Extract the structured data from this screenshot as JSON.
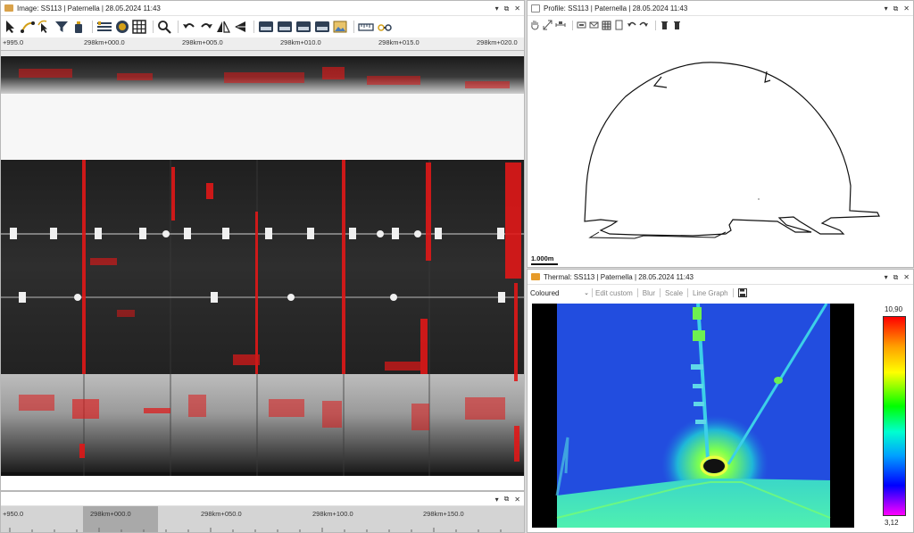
{
  "image_panel": {
    "title": "Image: SS113 | Paternella | 28.05.2024 11:43",
    "window_controls": [
      "▾",
      "⧉",
      "✕"
    ],
    "toolbar_icons": [
      "pointer-icon",
      "line-measure-icon",
      "select-icon",
      "filter-icon",
      "bucket-icon",
      "layers-icon",
      "tag-icon",
      "grid-icon",
      "zoom-icon",
      "undo-icon",
      "redo-icon",
      "flip-icon",
      "perspective-icon",
      "export-icon",
      "export-icon",
      "export-icon",
      "export-icon",
      "image-icon",
      "ruler-icon",
      "link-icon"
    ],
    "ruler_labels": [
      "+995.0",
      "298km+000.0",
      "298km+005.0",
      "298km+010.0",
      "298km+015.0",
      "298km+020.0"
    ]
  },
  "bottom_panel": {
    "window_controls": [
      "▾",
      "⧉",
      "✕"
    ],
    "ruler_labels": [
      "+950.0",
      "298km+000.0",
      "298km+050.0",
      "298km+100.0",
      "298km+150.0"
    ]
  },
  "profile_panel": {
    "title": "Profile: SS113 | Paternella | 28.05.2024 11:43",
    "window_controls": [
      "▾",
      "⧉",
      "✕"
    ],
    "toolbar_icons": [
      "hand-icon",
      "expand-icon",
      "measure-icon",
      "box-icon",
      "mail-icon",
      "grid-icon",
      "page-icon",
      "undo-icon",
      "redo-icon",
      "delete-icon",
      "delete-icon"
    ],
    "scale_label": "1.000m"
  },
  "thermal_panel": {
    "title": "Thermal: SS113 | Paternella | 28.05.2024 11:43",
    "window_controls": [
      "▾",
      "⧉",
      "✕"
    ],
    "palette_select": "Coloured",
    "actions": [
      "Edit custom",
      "Blur",
      "Scale",
      "Line Graph"
    ],
    "scale_max": "10,90",
    "scale_min": "3,12"
  },
  "colors": {
    "accent": "#d4a017",
    "crack_red": "#e01818",
    "panel_border": "#b8b8b8"
  }
}
